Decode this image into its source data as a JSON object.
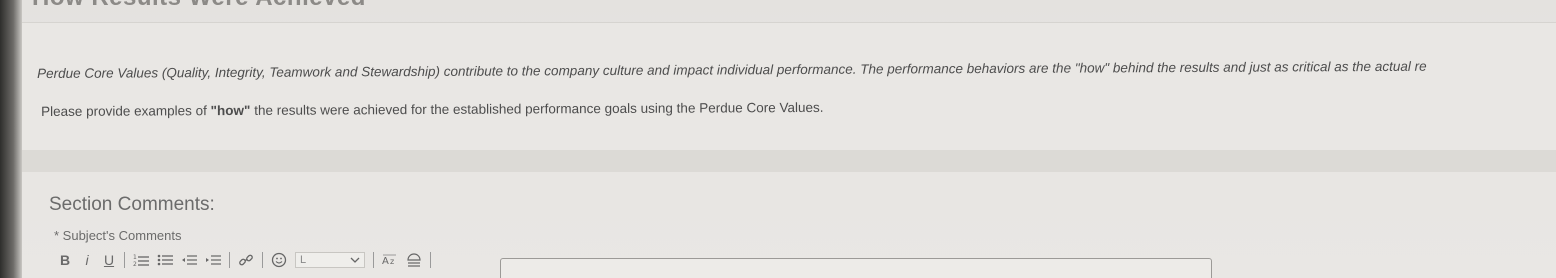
{
  "section": {
    "title": "How Results Were Achieved"
  },
  "description": {
    "paragraph_1": "Perdue Core Values (Quality, Integrity, Teamwork and Stewardship) contribute to the company culture and impact individual performance. The performance behaviors are the \"how\" behind the results and just as critical as the actual re",
    "paragraph_2_prefix": "Please provide examples of ",
    "paragraph_2_bold": "\"how\"",
    "paragraph_2_suffix": " the results were achieved for the established performance goals using the Perdue Core Values."
  },
  "comments": {
    "title": "Section Comments:",
    "field_label": "* Subject's Comments"
  },
  "toolbar": {
    "bold": "B",
    "italic": "i",
    "underline": "U",
    "font_size_value": "L",
    "icons": [
      "bold-icon",
      "italic-icon",
      "underline-icon",
      "numbered-list-icon",
      "bulleted-list-icon",
      "outdent-icon",
      "indent-icon",
      "link-icon",
      "emoji-icon",
      "font-size-dropdown",
      "spellcheck-icon",
      "clear-format-icon"
    ]
  }
}
